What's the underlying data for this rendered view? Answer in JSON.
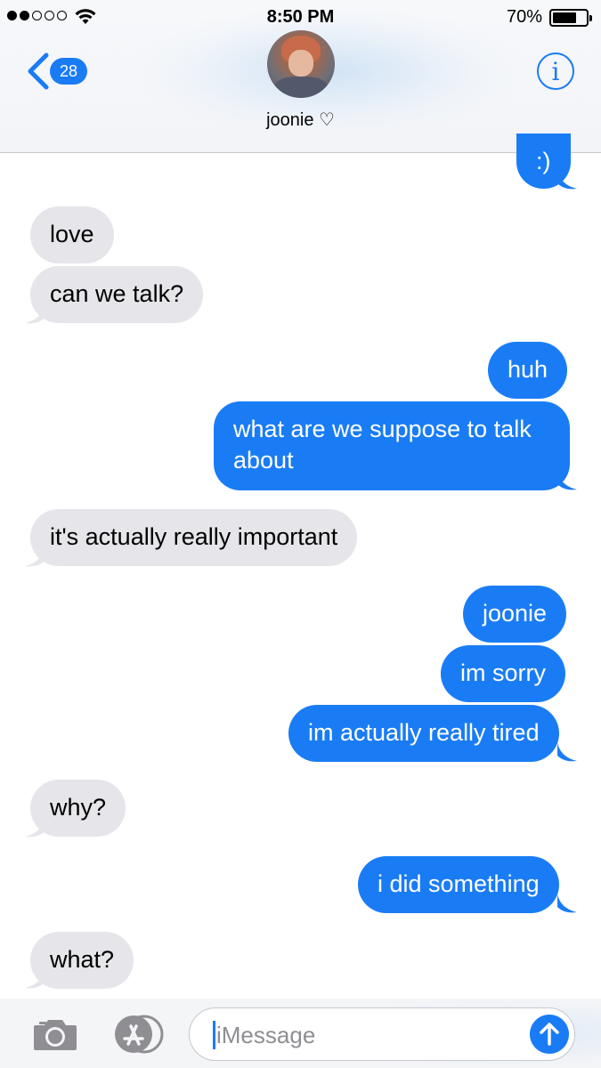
{
  "status_bar": {
    "time": "8:50 PM",
    "battery_percent": "70%",
    "signal_bars": 2,
    "battery_level": 0.7
  },
  "header": {
    "back_badge_count": "28",
    "contact_name": "joonie ♡",
    "info_icon": "i"
  },
  "messages": [
    {
      "side": "out",
      "text": ":)"
    },
    {
      "side": "in",
      "text": "love"
    },
    {
      "side": "in",
      "text": "can we talk?"
    },
    {
      "side": "out",
      "text": "huh"
    },
    {
      "side": "out",
      "text": "what are we suppose to talk about"
    },
    {
      "side": "in",
      "text": "it's actually really important"
    },
    {
      "side": "out",
      "text": "joonie"
    },
    {
      "side": "out",
      "text": "im sorry"
    },
    {
      "side": "out",
      "text": "im actually really tired"
    },
    {
      "side": "in",
      "text": "why?"
    },
    {
      "side": "out",
      "text": "i did something"
    },
    {
      "side": "in",
      "text": "what?"
    }
  ],
  "input_bar": {
    "placeholder": "iMessage",
    "icons": [
      "camera-icon",
      "app-store-icon",
      "send-arrow-icon"
    ]
  },
  "colors": {
    "accent": "#1a7cf5",
    "incoming_bubble": "#e5e5ea",
    "outgoing_bubble": "#1a7cf5"
  }
}
